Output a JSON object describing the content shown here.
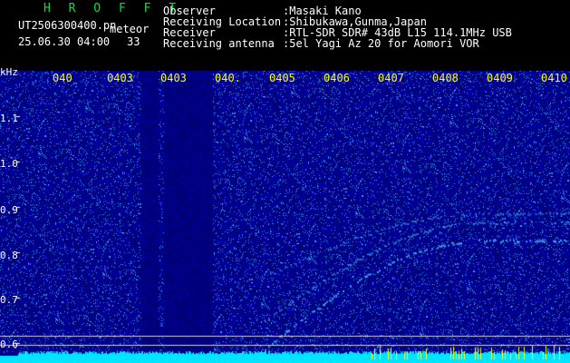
{
  "title": "H R O F F T",
  "file_name": "UT2506300400.pn",
  "mode": "meteor",
  "datetime": "25.06.30 04:00",
  "count": "33",
  "info": [
    {
      "label": "Observer",
      "value": ":Masaki Kano"
    },
    {
      "label": "Receiving Location",
      "value": ":Shibukawa,Gunma,Japan"
    },
    {
      "label": "Receiver",
      "value": ":RTL-SDR SDR# 43dB L15 114.1MHz USB"
    },
    {
      "label": "Receiving antenna",
      "value": ":5el Yagi Az 20 for Aomori VOR"
    }
  ],
  "unit_label": "kHz",
  "time_ticks": [
    "040",
    "0403",
    "0403",
    "040.",
    "0405",
    "0406",
    "0407",
    "0408",
    "0409",
    "0410"
  ],
  "freq_ticks": [
    "1.1",
    "1.0",
    "0.9",
    "0.8",
    "0.7",
    "0.6"
  ],
  "colors": {
    "header_title": "#00e14b",
    "tick_labels": "#ffff00",
    "background": "#00007a",
    "baseline": "#00e5ff"
  }
}
